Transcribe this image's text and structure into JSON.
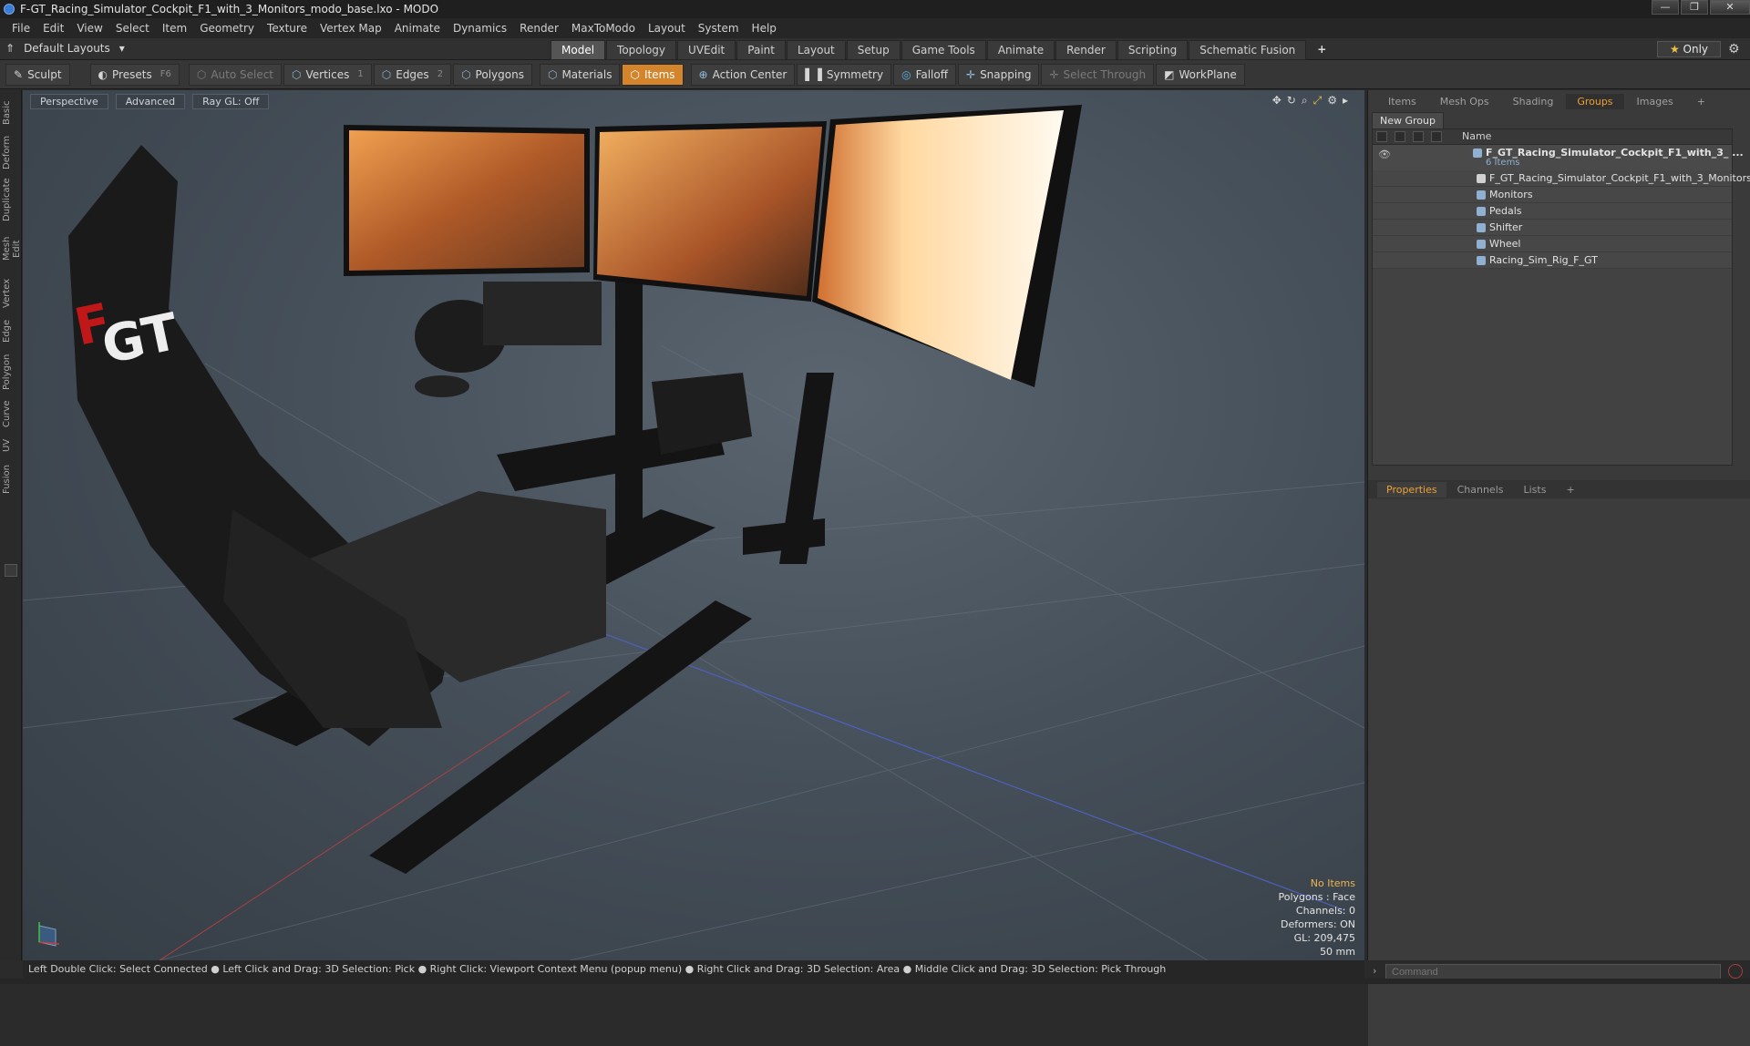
{
  "window": {
    "title": "F-GT_Racing_Simulator_Cockpit_F1_with_3_Monitors_modo_base.lxo - MODO",
    "controls": [
      "—",
      "❐",
      "✕"
    ]
  },
  "menu": [
    "File",
    "Edit",
    "View",
    "Select",
    "Item",
    "Geometry",
    "Texture",
    "Vertex Map",
    "Animate",
    "Dynamics",
    "Render",
    "MaxToModo",
    "Layout",
    "System",
    "Help"
  ],
  "layout_bar": {
    "default_layouts": "Default Layouts",
    "tabs": [
      "Model",
      "Topology",
      "UVEdit",
      "Paint",
      "Layout",
      "Setup",
      "Game Tools",
      "Animate",
      "Render",
      "Scripting",
      "Schematic Fusion"
    ],
    "active_tab": "Model",
    "only_label": "Only"
  },
  "toolbar": {
    "sculpt": "Sculpt",
    "presets": "Presets",
    "presets_key": "F6",
    "auto_select": "Auto Select",
    "vertices": "Vertices",
    "vertices_count": "1",
    "edges": "Edges",
    "edges_count": "2",
    "polygons": "Polygons",
    "materials": "Materials",
    "items": "Items",
    "action_center": "Action Center",
    "symmetry": "Symmetry",
    "falloff": "Falloff",
    "snapping": "Snapping",
    "select_through": "Select Through",
    "workplane": "WorkPlane"
  },
  "left_tabs": [
    "Basic",
    "Deform",
    "Duplicate",
    "Mesh Edit",
    "Vertex",
    "Edge",
    "Polygon",
    "Curve",
    "UV",
    "Fusion"
  ],
  "viewport": {
    "view_mode": "Perspective",
    "advanced": "Advanced",
    "raygl": "Ray GL: Off",
    "stats": {
      "no_items": "No Items",
      "polygons": "Polygons : Face",
      "channels": "Channels: 0",
      "deformers": "Deformers: ON",
      "gl": "GL: 209,475",
      "focal": "50 mm"
    }
  },
  "right_panel": {
    "tabs": [
      "Items",
      "Mesh Ops",
      "Shading",
      "Groups",
      "Images"
    ],
    "active_tab": "Groups",
    "new_group": "New Group",
    "name_header": "Name",
    "root": {
      "label": "F_GT_Racing_Simulator_Cockpit_F1_with_3_ ...",
      "count": "6 Items"
    },
    "children": [
      "F_GT_Racing_Simulator_Cockpit_F1_with_3_Monitors",
      "Monitors",
      "Pedals",
      "Shifter",
      "Wheel",
      "Racing_Sim_Rig_F_GT"
    ],
    "props_tabs": [
      "Properties",
      "Channels",
      "Lists"
    ],
    "props_active": "Properties"
  },
  "statusbar": "Left Double Click: Select Connected ● Left Click and Drag: 3D Selection: Pick ● Right Click: Viewport Context Menu (popup menu) ● Right Click and Drag: 3D Selection: Area ● Middle Click and Drag: 3D Selection: Pick Through",
  "command": {
    "placeholder": "Command"
  },
  "colors": {
    "accent": "#d4842a",
    "active_tab_text": "#f0a030"
  }
}
